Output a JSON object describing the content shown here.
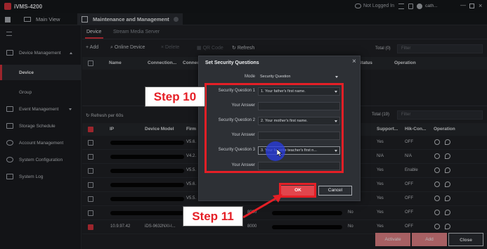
{
  "app": {
    "title": "iVMS-4200",
    "status": "Not Logged In",
    "user": "cath..."
  },
  "tabs": [
    {
      "label": "Main View"
    },
    {
      "label": "Maintenance and Management"
    }
  ],
  "sidebar": {
    "items": [
      {
        "label": "Device Management"
      },
      {
        "label": "Device"
      },
      {
        "label": "Group"
      },
      {
        "label": "Event Management"
      },
      {
        "label": "Storage Schedule"
      },
      {
        "label": "Account Management"
      },
      {
        "label": "System Configuration"
      },
      {
        "label": "System Log"
      }
    ]
  },
  "main": {
    "subtabs": [
      "Device",
      "Stream Media Server"
    ],
    "toolbar": {
      "add": "Add",
      "online_device": "Online Device",
      "delete": "Delete",
      "qr_code": "QR Code",
      "refresh": "Refresh"
    },
    "top_table": {
      "total": "Total (0)",
      "filter": "Filter",
      "headers": [
        "Name",
        "Connection...",
        "Connect",
        "Status",
        "Operation"
      ]
    },
    "online": {
      "refresh_label": "Refresh per 60s",
      "total": "Total (19)",
      "filter": "Filter",
      "headers": [
        "IP",
        "Device Model",
        "Firm",
        "Support...",
        "Hik-Con...",
        "Operation"
      ],
      "rows": [
        {
          "ip": "",
          "model": "",
          "firm": "V5.6.",
          "support": "Yes",
          "hik": "OFF"
        },
        {
          "ip": "",
          "model": "",
          "firm": "V4.2.",
          "support": "N/A",
          "hik": "N/A"
        },
        {
          "ip": "",
          "model": "",
          "firm": "V5.5.",
          "support": "Yes",
          "hik": "Enable"
        },
        {
          "ip": "",
          "model": "",
          "firm": "V5.6.",
          "support": "Yes",
          "hik": "OFF"
        },
        {
          "ip": "",
          "model": "",
          "firm": "V5.5.",
          "support": "Yes",
          "hik": "OFF"
        },
        {
          "ip": "",
          "model": "",
          "firm": "",
          "port": "8000",
          "nov": "No",
          "support": "Yes",
          "hik": "OFF"
        },
        {
          "ip": "10.9.97.42",
          "model": "iDS-9632NXI-I...",
          "firm": "",
          "port": "8000",
          "nov": "No",
          "support": "Yes",
          "hik": "OFF"
        }
      ],
      "buttons": {
        "activate": "Activate",
        "add": "Add",
        "close": "Close"
      }
    }
  },
  "dialog": {
    "title": "Set Security Questions",
    "mode_label": "Mode",
    "mode_value": "Security Question",
    "q1_label": "Security Question 1",
    "q1_value": "1. Your father's first name.",
    "a1_label": "Your Answer",
    "q2_label": "Security Question 2",
    "q2_value": "2. Your mother's first name.",
    "a2_label": "Your Answer",
    "q3_label": "Security Question 3",
    "q3_value": "3. Your favorite teacher's first n...",
    "a3_label": "Your Answer",
    "ok": "OK",
    "cancel": "Cancel"
  },
  "annotations": {
    "step10": "Step 10",
    "step11": "Step 11"
  },
  "colors": {
    "accent": "#d9343d",
    "highlight": "#e51f26"
  }
}
